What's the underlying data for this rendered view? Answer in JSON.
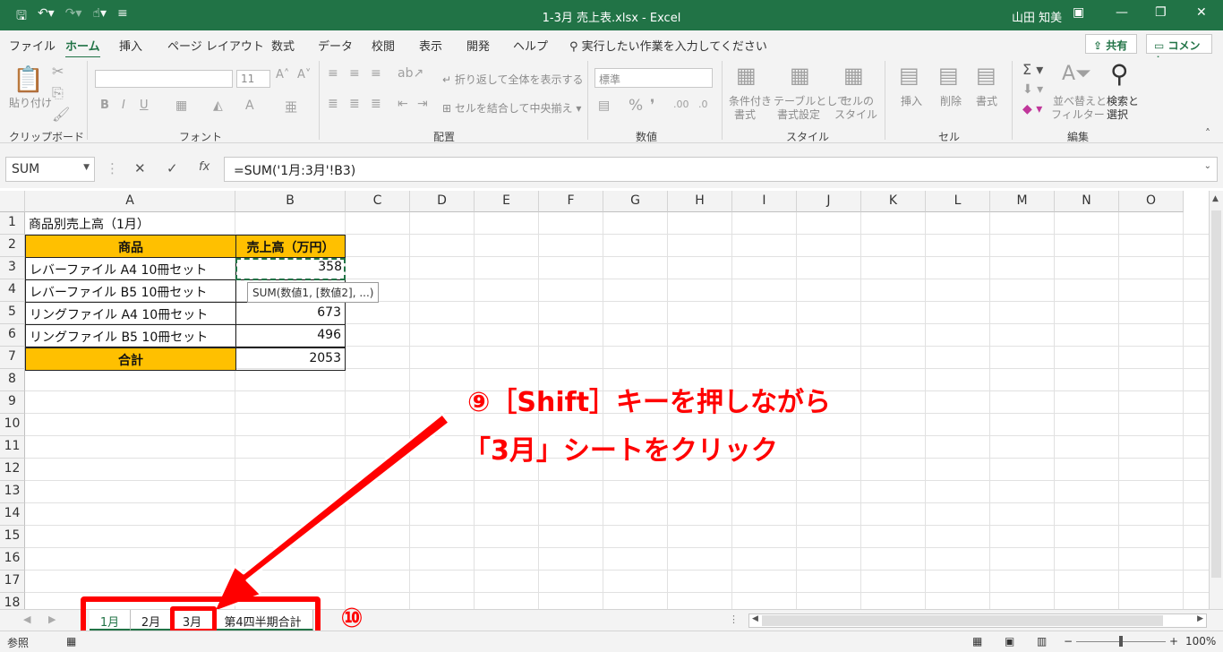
{
  "titlebar": {
    "title": "1-3月 売上表.xlsx  -  Excel",
    "user": "山田 知美",
    "qat_icons": [
      "save-icon",
      "undo-icon",
      "redo-icon",
      "touch-mode-icon",
      "customize-icon"
    ]
  },
  "menu": {
    "tabs": [
      "ファイル",
      "ホーム",
      "挿入",
      "ページ レイアウト",
      "数式",
      "データ",
      "校閲",
      "表示",
      "開発",
      "ヘルプ"
    ],
    "active_tab": "ホーム",
    "tell_me": "実行したい作業を入力してください",
    "share": "共有",
    "comment": "コメント"
  },
  "ribbon": {
    "groups": [
      "クリップボード",
      "フォント",
      "配置",
      "数値",
      "スタイル",
      "セル",
      "編集"
    ],
    "paste": "貼り付け",
    "font_size": "11",
    "wrap_text": "折り返して全体を表示する",
    "merge_center": "セルを結合して中央揃え",
    "number_format": "標準",
    "conditional_format": "条件付き",
    "conditional_format2": "書式",
    "table_format": "テーブルとして",
    "table_format2": "書式設定",
    "cell_style": "セルの",
    "cell_style2": "スタイル",
    "insert": "挿入",
    "delete": "削除",
    "format": "書式",
    "sort_filter": "並べ替えと",
    "sort_filter2": "フィルター",
    "find_select": "検索と",
    "find_select2": "選択"
  },
  "formula_bar": {
    "name_box": "SUM",
    "formula": "=SUM('1月:3月'!B3)"
  },
  "columns": [
    "A",
    "B",
    "C",
    "D",
    "E",
    "F",
    "G",
    "H",
    "I",
    "J",
    "K",
    "L",
    "M",
    "N",
    "O"
  ],
  "rows": [
    "1",
    "2",
    "3",
    "4",
    "5",
    "6",
    "7",
    "8",
    "9",
    "10",
    "11",
    "12",
    "13",
    "14",
    "15",
    "16",
    "17",
    "18"
  ],
  "sheet": {
    "title": "商品別売上高（1月）",
    "header_product": "商品",
    "header_sales": "売上高（万円）",
    "items": [
      {
        "name": "レバーファイル A4 10冊セット",
        "value": "358"
      },
      {
        "name": "レバーファイル B5 10冊セット",
        "value": ""
      },
      {
        "name": "リングファイル A4 10冊セット",
        "value": "673"
      },
      {
        "name": "リングファイル B5 10冊セット",
        "value": "496"
      }
    ],
    "total_label": "合計",
    "total_value": "2053",
    "tooltip": "SUM(数値1, [数値2], ...)"
  },
  "annotation": {
    "line1": "⑨［Shift］キーを押しながら",
    "line2": "「3月」シートをクリック",
    "step10": "⑩"
  },
  "sheet_tabs": [
    "1月",
    "2月",
    "3月",
    "第4四半期合計"
  ],
  "status": {
    "mode": "参照",
    "zoom": "100%"
  },
  "accent_color": "#217346",
  "highlight_color": "#ffc000",
  "annotation_color": "#ff0000"
}
